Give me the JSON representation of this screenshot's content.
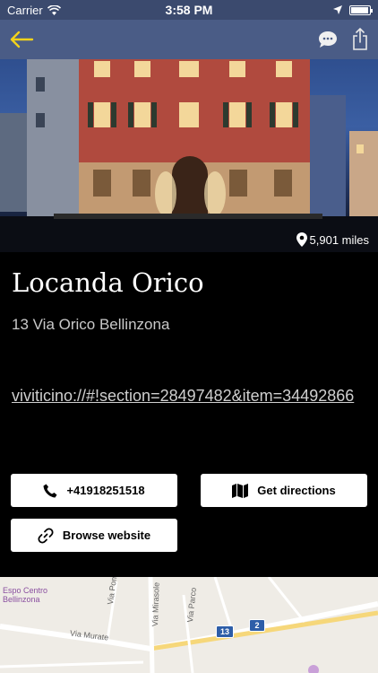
{
  "status": {
    "carrier": "Carrier",
    "time": "3:58 PM"
  },
  "nav": {
    "back_icon": "arrow-left-icon",
    "chat_icon": "chat-bubble-icon",
    "share_icon": "share-icon"
  },
  "hero": {
    "distance": "5,901 miles"
  },
  "place": {
    "name": "Locanda Orico",
    "address": "13 Via Orico Bellinzona",
    "link": "viviticino://#!section=28497482&item=34492866"
  },
  "actions": {
    "call_label": "+41918251518",
    "directions_label": "Get directions",
    "website_label": "Browse website"
  },
  "map": {
    "labels": {
      "poi": "Espo Centro\nBellinzona",
      "street1": "Via Pometta",
      "street2": "Via Mirasole",
      "street3": "Via Parco",
      "street4": "Via Murate"
    },
    "badges": [
      "13",
      "2"
    ]
  },
  "colors": {
    "accent": "#f2d21b",
    "nav_bg": "#4a5c86",
    "background": "#000000"
  }
}
